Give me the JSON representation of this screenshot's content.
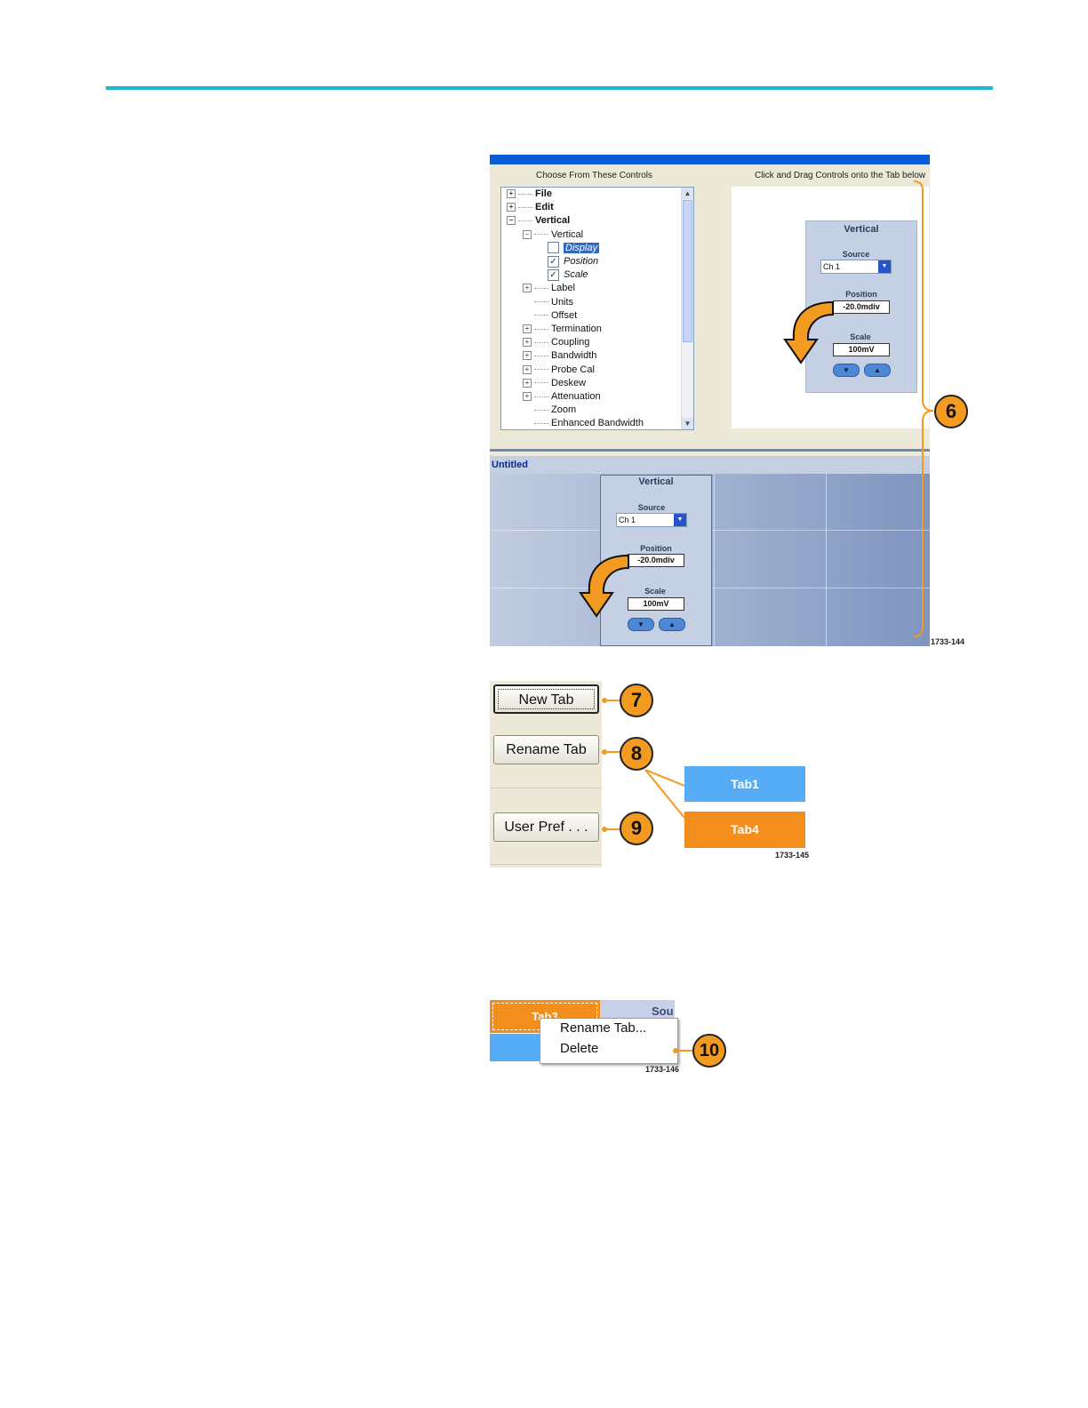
{
  "fig1": {
    "left_heading": "Choose From These Controls",
    "right_heading": "Click and Drag Controls onto the Tab below",
    "tree": [
      {
        "label": "File",
        "level": 0,
        "bold": true,
        "expander": "+"
      },
      {
        "label": "Edit",
        "level": 0,
        "bold": true,
        "expander": "+"
      },
      {
        "label": "Vertical",
        "level": 0,
        "bold": true,
        "expander": "−"
      },
      {
        "label": "Vertical",
        "level": 1,
        "expander": "−"
      },
      {
        "label": "Display",
        "level": 2,
        "checkbox": "unchecked",
        "italic": true,
        "selected": true
      },
      {
        "label": "Position",
        "level": 2,
        "checkbox": "checked",
        "italic": true
      },
      {
        "label": "Scale",
        "level": 2,
        "checkbox": "checked",
        "italic": true
      },
      {
        "label": "Label",
        "level": 1,
        "expander": "+"
      },
      {
        "label": "Units",
        "level": 1
      },
      {
        "label": "Offset",
        "level": 1
      },
      {
        "label": "Termination",
        "level": 1,
        "expander": "+"
      },
      {
        "label": "Coupling",
        "level": 1,
        "expander": "+"
      },
      {
        "label": "Bandwidth",
        "level": 1,
        "expander": "+"
      },
      {
        "label": "Probe Cal",
        "level": 1,
        "expander": "+"
      },
      {
        "label": "Deskew",
        "level": 1,
        "expander": "+"
      },
      {
        "label": "Attenuation",
        "level": 1,
        "expander": "+"
      },
      {
        "label": "Zoom",
        "level": 1
      },
      {
        "label": "Enhanced Bandwidth",
        "level": 1
      }
    ],
    "vpanel": {
      "title": "Vertical",
      "source_label": "Source",
      "source_value": "Ch 1",
      "position_label": "Position",
      "position_value": "-20.0mdiv",
      "scale_label": "Scale",
      "scale_value": "100mV",
      "down_glyph": "▼",
      "up_glyph": "▲"
    },
    "tab_title": "Untitled",
    "figure_code": "1733-144",
    "callout": "6"
  },
  "fig2": {
    "buttons": [
      {
        "label": "New Tab",
        "callout": "7"
      },
      {
        "label": "Rename Tab",
        "callout": "8"
      },
      {
        "label": "User Pref . . .",
        "callout": "9"
      }
    ],
    "tabs": [
      "Tab1",
      "Tab4"
    ],
    "figure_code": "1733-145"
  },
  "fig3": {
    "bg_tab_orange": "Tab3",
    "bg_tab_blue": "T",
    "bg_header": "Sou",
    "menu": [
      "Rename Tab...",
      "Delete"
    ],
    "figure_code": "1733-146",
    "callout": "10"
  },
  "colors": {
    "rule": "#1fb7d2",
    "callout": "#f39a21",
    "tab_blue": "#56adf6",
    "tab_orange": "#f38d1c",
    "titlebar": "#0a5bd8"
  }
}
